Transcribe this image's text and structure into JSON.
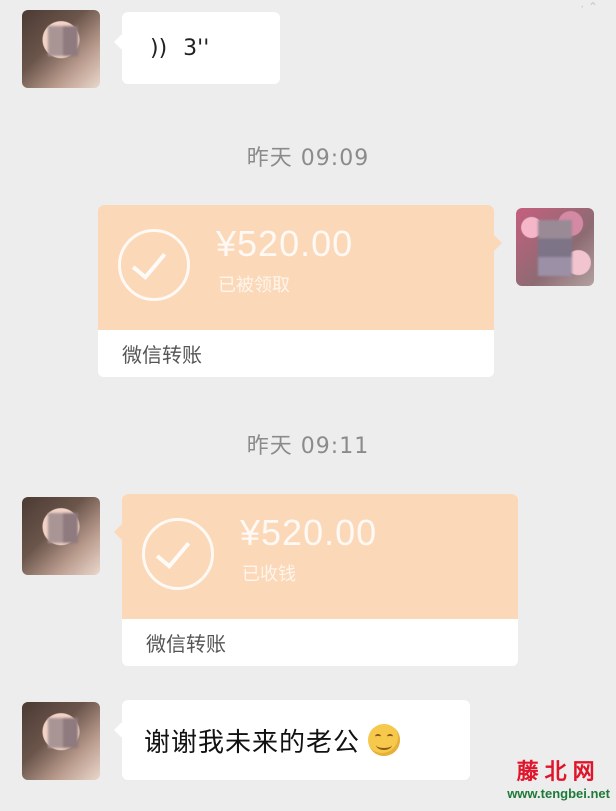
{
  "messages": {
    "voice": {
      "duration": "3''"
    },
    "time1": "昨天 09:09",
    "transfer1": {
      "amount": "¥520.00",
      "status": "已被领取",
      "label": "微信转账"
    },
    "time2": "昨天 09:11",
    "transfer2": {
      "amount": "¥520.00",
      "status": "已收钱",
      "label": "微信转账"
    },
    "text": {
      "content": "谢谢我未来的老公"
    }
  },
  "watermark": {
    "name": "藤北网",
    "url": "www.tengbei.net"
  },
  "colors": {
    "background": "#ededed",
    "transfer_bg": "#fbd8b8",
    "bubble": "#ffffff",
    "time_text": "#8b8b8b",
    "watermark_red": "#e0142a",
    "watermark_green": "#1f7a3a"
  }
}
